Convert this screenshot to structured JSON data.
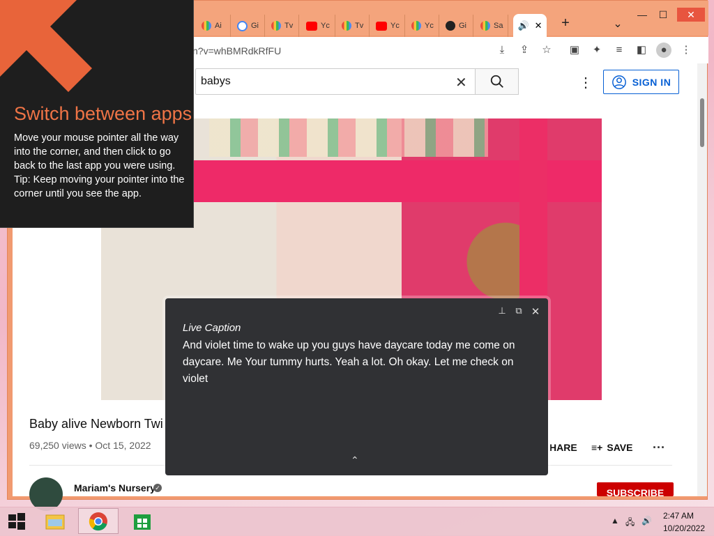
{
  "browser": {
    "tabs": [
      {
        "label": "Ai",
        "icon": "multicolor-favicon"
      },
      {
        "label": "Gi",
        "icon": "google-icon"
      },
      {
        "label": "Tv",
        "icon": "multicolor-favicon"
      },
      {
        "label": "Yc",
        "icon": "youtube-icon"
      },
      {
        "label": "Tv",
        "icon": "multicolor-favicon"
      },
      {
        "label": "Yc",
        "icon": "youtube-icon"
      },
      {
        "label": "Yc",
        "icon": "multicolor-favicon"
      },
      {
        "label": "Gi",
        "icon": "github-icon"
      },
      {
        "label": "Sa",
        "icon": "multicolor-favicon"
      }
    ],
    "active_tab_icon": "🔊",
    "active_tab_close": "✕",
    "new_tab": "+",
    "tab_menu": "⌄",
    "url": "n?v=whBMRdkRfFU",
    "window_controls": {
      "minimize": "—",
      "maximize": "☐",
      "close": "✕"
    }
  },
  "youtube": {
    "search_value": "babys",
    "clear": "✕",
    "menu": "⋮",
    "sign_in": "SIGN IN",
    "video_title": "Baby alive Newborn Twi",
    "views": "69,250 views",
    "date": "Oct 15, 2022",
    "share": "HARE",
    "save": "SAVE",
    "more": "···",
    "channel": "Mariam's Nursery",
    "subscribe": "SUBSCRIBE"
  },
  "switch_apps": {
    "title": "Switch between apps",
    "body": "Move your mouse pointer all the way into the corner, and then click to go back to the last app you were using.",
    "tip": "Tip: Keep moving your pointer into the corner until you see the app."
  },
  "live_caption": {
    "heading": "Live Caption",
    "text": "And violet time to wake up you guys have daycare today me come on daycare. Me Your tummy hurts. Yeah a lot. Oh okay. Let me check on violet",
    "expand": "⌃"
  },
  "taskbar": {
    "time": "2:47 AM",
    "date": "10/20/2022"
  },
  "colors": {
    "accent_blue": "#065fd4",
    "subscribe_red": "#cc0000",
    "switch_title_orange": "#ef7446",
    "caption_bg": "#303134",
    "window_frame": "#f19a70"
  }
}
